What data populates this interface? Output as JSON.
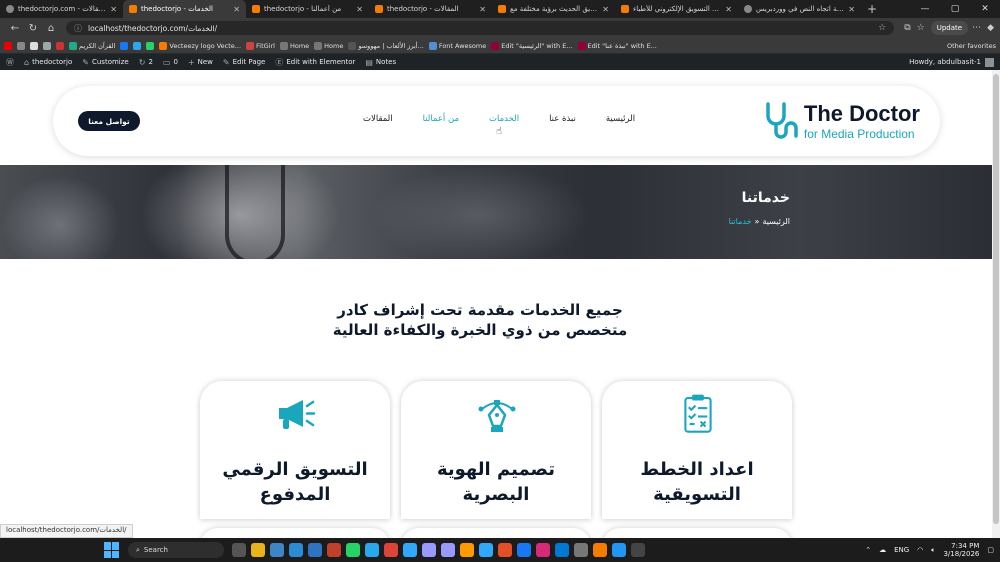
{
  "browser": {
    "tabs": [
      {
        "title": "thedoctorjo.com - المقالات",
        "active": false
      },
      {
        "title": "thedoctorjo - الخدمات",
        "active": true
      },
      {
        "title": "thedoctorjo - من أعمالنا",
        "active": false
      },
      {
        "title": "thedoctorjo - المقالات",
        "active": false
      },
      {
        "title": "التسويق الحديث برؤية مختلفة مع ...",
        "active": false
      },
      {
        "title": "ما أهمية التسويق الإلكتروني للأطباء",
        "active": false
      },
      {
        "title": "مشكلة اتجاه النص في ووردبريس",
        "active": false
      }
    ],
    "address": "localhost/thedoctorjo.com/الخدمات/",
    "update_label": "Update",
    "bookmarks": [
      "Vecteezy logo Vecte...",
      "FitGirl",
      "Home",
      "Home",
      "أبرز الألعاب | مهووسو...",
      "القرآن الكريم",
      "Font Awesome",
      "Edit \"الرئيسية\" with E...",
      "Edit \"نبذة عنا\" with E..."
    ],
    "other_favorites": "Other favorites"
  },
  "wp_admin": {
    "site": "thedoctorjo",
    "customize": "Customize",
    "updates": "2",
    "comments": "0",
    "new": "New",
    "edit_page": "Edit Page",
    "elementor": "Edit with Elementor",
    "notes": "Notes",
    "howdy": "Howdy, abdulbasit-1"
  },
  "header": {
    "logo_name": "The Doctor",
    "logo_tag": "for Media Production",
    "cta": "تواصل معنا",
    "menu": [
      {
        "label": "الرئيسية",
        "active": false
      },
      {
        "label": "نبذة عنا",
        "active": false
      },
      {
        "label": "الخدمات",
        "active": true
      },
      {
        "label": "من أعمالنا",
        "active": true
      },
      {
        "label": "المقالات",
        "active": false
      }
    ]
  },
  "hero": {
    "title": "خدماتنا",
    "breadcrumb_home": "الرئيسية",
    "breadcrumb_sep": "»",
    "breadcrumb_current": "خدماتنا"
  },
  "section": {
    "heading_line1": "جميع الخدمات مقدمة تحت إشراف كادر",
    "heading_line2": "متخصص من ذوي الخبرة والكفاءة العالية"
  },
  "cards": [
    {
      "title": "التسويق الرقمي المدفوع",
      "icon": "megaphone-icon"
    },
    {
      "title": "تصميم الهوية البصرية",
      "icon": "pen-nib-icon"
    },
    {
      "title": "اعداد الخطط التسويقية",
      "icon": "clipboard-checklist-icon"
    }
  ],
  "status_url": "localhost/thedoctorjo.com/الخدمات/",
  "taskbar": {
    "search": "Search",
    "lang": "ENG",
    "time": "7:34 PM",
    "date": "3/18/2026"
  },
  "colors": {
    "brand_dark": "#0e1a2b",
    "accent_teal": "#1aa6bd"
  }
}
